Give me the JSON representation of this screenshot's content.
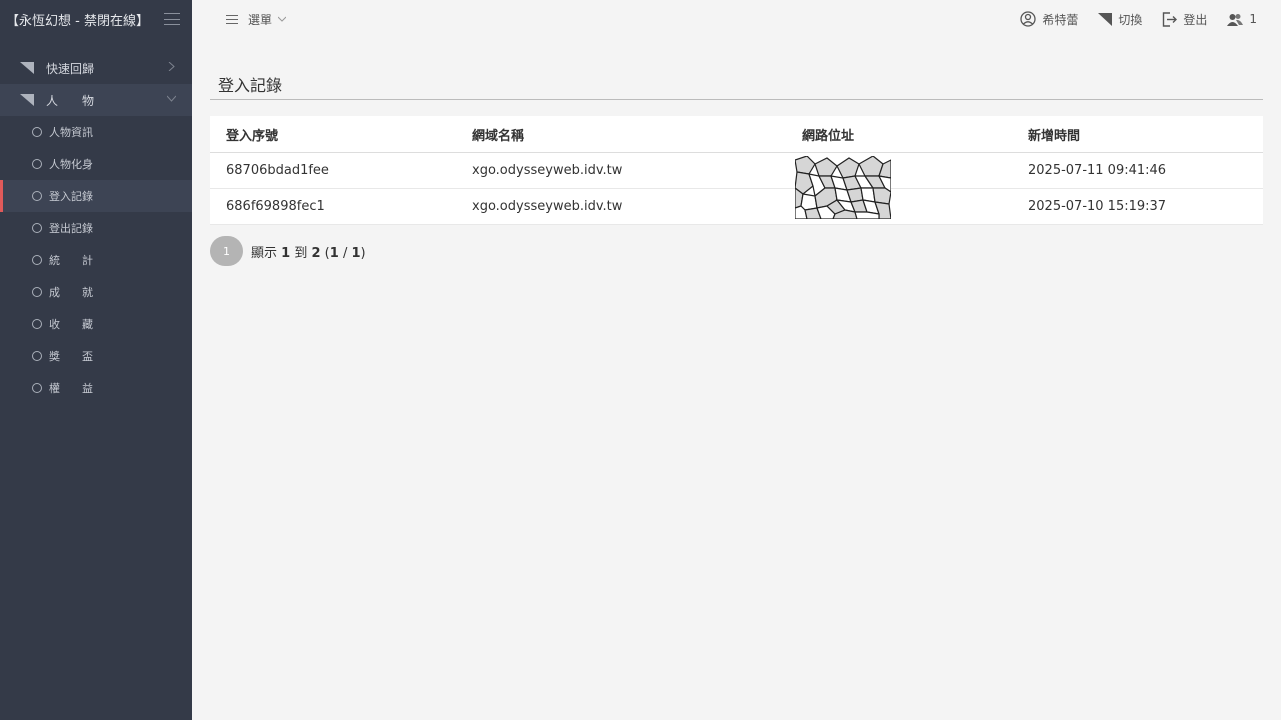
{
  "sidebar": {
    "brand": "【永恆幻想 - 禁閉在線】",
    "groups": [
      {
        "label": "快速回歸"
      },
      {
        "label": "人　　物"
      }
    ],
    "items": [
      {
        "label": "人物資訊"
      },
      {
        "label": "人物化身"
      },
      {
        "label": "登入記錄"
      },
      {
        "label": "登出記錄"
      },
      {
        "label": "統　　計"
      },
      {
        "label": "成　　就"
      },
      {
        "label": "收　　藏"
      },
      {
        "label": "獎　　盃"
      },
      {
        "label": "權　　益"
      }
    ]
  },
  "topbar": {
    "menu_label": "選單",
    "user_name": "希特蕾",
    "switch_label": "切換",
    "logout_label": "登出",
    "online_count": "1"
  },
  "main": {
    "title": "登入記錄",
    "columns": [
      "登入序號",
      "網域名稱",
      "網路位址",
      "新增時間"
    ],
    "rows": [
      {
        "id": "68706bdad1fee",
        "domain": "xgo.odysseyweb.idv.tw",
        "ip": "",
        "time": "2025-07-11 09:41:46"
      },
      {
        "id": "686f69898fec1",
        "domain": "xgo.odysseyweb.idv.tw",
        "ip": "",
        "time": "2025-07-10 15:19:37"
      }
    ],
    "pager": {
      "current_page": "1",
      "prefix": "顯示",
      "from": "1",
      "to_word": "到",
      "to": "2",
      "page": "1",
      "pages": "1"
    }
  }
}
